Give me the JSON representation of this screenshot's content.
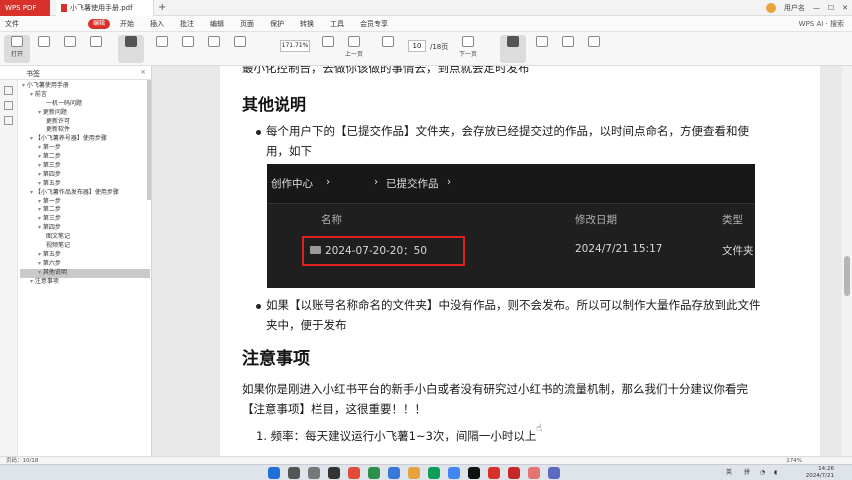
{
  "titlebar": {
    "app": "WPS PDF",
    "doc_tab": "小飞薯使用手册.pdf",
    "new_tab": "+",
    "user": "用户名"
  },
  "menubar": {
    "file": "文件",
    "items": [
      "开始",
      "插入",
      "批注",
      "编辑",
      "页面",
      "保护",
      "转换",
      "工具",
      "会员专享"
    ],
    "badge": "编辑",
    "right": "WPS AI · 搜索"
  },
  "toolbar": {
    "buttons": [
      "打开",
      "PDF转换",
      "播放",
      "编辑文字",
      "编辑图片",
      "阅读模式",
      "背景",
      "查找",
      "旋转",
      "适合页面",
      "单页",
      "双页",
      "连续阅读",
      "上一页",
      "下一页",
      "首页",
      "尾页",
      "截图",
      "翻译",
      "朗读",
      "自动滚动"
    ],
    "zoom": "171.71%",
    "page_current": "10",
    "page_total": "/18页",
    "labels": {
      "prev": "上一页",
      "next": "下一页"
    }
  },
  "sidepanel": {
    "tab": "书签",
    "close": "×",
    "tree": [
      {
        "label": "小飞薯使用手册",
        "depth": 0
      },
      {
        "label": "前言",
        "depth": 1
      },
      {
        "label": "一机一码问题",
        "depth": 3
      },
      {
        "label": "更新问题",
        "depth": 2
      },
      {
        "label": "更新许可",
        "depth": 3
      },
      {
        "label": "更新软件",
        "depth": 3
      },
      {
        "label": "【小飞薯养号器】使用步骤",
        "depth": 1
      },
      {
        "label": "第一步",
        "depth": 2
      },
      {
        "label": "第二步",
        "depth": 2
      },
      {
        "label": "第三步",
        "depth": 2
      },
      {
        "label": "第四步",
        "depth": 2
      },
      {
        "label": "第五步",
        "depth": 2
      },
      {
        "label": "【小飞薯作品发布器】使用步骤",
        "depth": 1
      },
      {
        "label": "第一步",
        "depth": 2
      },
      {
        "label": "第二步",
        "depth": 2
      },
      {
        "label": "第三步",
        "depth": 2
      },
      {
        "label": "第四步",
        "depth": 2
      },
      {
        "label": "图文笔记",
        "depth": 3
      },
      {
        "label": "视频笔记",
        "depth": 3
      },
      {
        "label": "第五步",
        "depth": 2
      },
      {
        "label": "第六步",
        "depth": 2
      },
      {
        "label": "其他说明",
        "depth": 2,
        "selected": true
      },
      {
        "label": "注意事项",
        "depth": 1
      }
    ]
  },
  "content": {
    "line_top": "最小化控制台，去做你该做的事情去，到点就会定时发布",
    "heading1": "其他说明",
    "bullet1_l1": "每个用户下的【已提交作品】文件夹，会存放已经提交过的作品，以时间点命名，方便查看和使",
    "bullet1_l2": "用，如下",
    "screenshot": {
      "crumb1": "创作中心",
      "sep1": "›",
      "crumb2": "已提交作品",
      "sep2": "›",
      "col_name": "名称",
      "col_date": "修改日期",
      "col_type": "类型",
      "row_name": "2024-07-20-20：50",
      "row_date": "2024/7/21 15:17",
      "row_type": "文件夹"
    },
    "bullet2_l1": "如果【以账号名称命名的文件夹】中没有作品，则不会发布。所以可以制作大量作品存放到此文件",
    "bullet2_l2": "夹中，便于发布",
    "heading2": "注意事项",
    "para_l1": "如果你是刚进入小红书平台的新手小白或者没有研究过小红书的流量机制，那么我们十分建议你看完",
    "para_l2": "【注意事项】栏目，这很重要！！！",
    "item1": "1. 频率：每天建议运行小飞薯1~3次，间隔一小时以上"
  },
  "statusbar": {
    "left": "页码：10/18",
    "right": "174%"
  },
  "taskbar": {
    "tray_lang": "英",
    "tray_ime": "拼",
    "time": "14:26",
    "date": "2024/7/21"
  },
  "colors": {
    "accent": "#d8302b",
    "highlight_box": "#e02020",
    "dark_panel": "#1f1f1f"
  }
}
